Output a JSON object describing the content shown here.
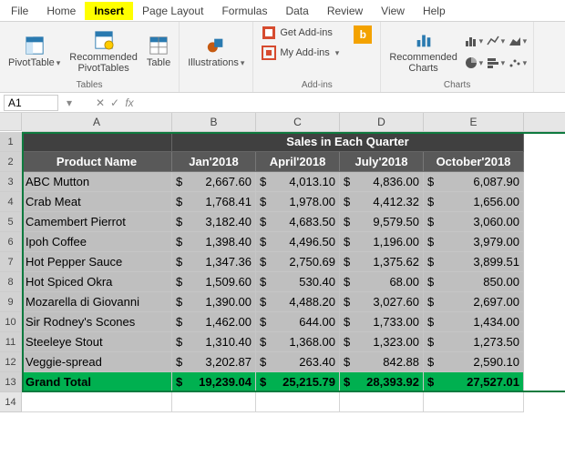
{
  "menu": {
    "items": [
      "File",
      "Home",
      "Insert",
      "Page Layout",
      "Formulas",
      "Data",
      "Review",
      "View",
      "Help"
    ],
    "active": "Insert"
  },
  "ribbon": {
    "tables": {
      "label": "Tables",
      "pivottable": "PivotTable",
      "recommended_pivot": "Recommended\nPivotTables",
      "table": "Table"
    },
    "illustrations": {
      "label": "Illustrations",
      "btn": "Illustrations"
    },
    "addins": {
      "label": "Add-ins",
      "get": "Get Add-ins",
      "my": "My Add-ins",
      "bing": "b"
    },
    "charts": {
      "label": "Charts",
      "recommended": "Recommended\nCharts"
    }
  },
  "name_box": "A1",
  "formula_bar": "",
  "columns": [
    "A",
    "B",
    "C",
    "D",
    "E"
  ],
  "table": {
    "title": "Sales in Each Quarter",
    "headers": [
      "Product Name",
      "Jan'2018",
      "April'2018",
      "July'2018",
      "October'2018"
    ],
    "rows": [
      {
        "name": "ABC Mutton",
        "v": [
          "2,667.60",
          "4,013.10",
          "4,836.00",
          "6,087.90"
        ]
      },
      {
        "name": "Crab Meat",
        "v": [
          "1,768.41",
          "1,978.00",
          "4,412.32",
          "1,656.00"
        ]
      },
      {
        "name": "Camembert Pierrot",
        "v": [
          "3,182.40",
          "4,683.50",
          "9,579.50",
          "3,060.00"
        ]
      },
      {
        "name": "Ipoh Coffee",
        "v": [
          "1,398.40",
          "4,496.50",
          "1,196.00",
          "3,979.00"
        ]
      },
      {
        "name": "Hot Pepper Sauce",
        "v": [
          "1,347.36",
          "2,750.69",
          "1,375.62",
          "3,899.51"
        ]
      },
      {
        "name": " Hot Spiced Okra",
        "v": [
          "1,509.60",
          "530.40",
          "68.00",
          "850.00"
        ]
      },
      {
        "name": "Mozarella di Giovanni",
        "v": [
          "1,390.00",
          "4,488.20",
          "3,027.60",
          "2,697.00"
        ]
      },
      {
        "name": "Sir Rodney's Scones",
        "v": [
          "1,462.00",
          "644.00",
          "1,733.00",
          "1,434.00"
        ]
      },
      {
        "name": "Steeleye Stout",
        "v": [
          "1,310.40",
          "1,368.00",
          "1,323.00",
          "1,273.50"
        ]
      },
      {
        "name": "Veggie-spread",
        "v": [
          "3,202.87",
          "263.40",
          "842.88",
          "2,590.10"
        ]
      }
    ],
    "total": {
      "label": "Grand Total",
      "v": [
        "19,239.04",
        "25,215.79",
        "28,393.92",
        "27,527.01"
      ]
    }
  },
  "chart_data": {
    "type": "table",
    "title": "Sales in Each Quarter",
    "categories": [
      "Jan'2018",
      "April'2018",
      "July'2018",
      "October'2018"
    ],
    "series": [
      {
        "name": "ABC Mutton",
        "values": [
          2667.6,
          4013.1,
          4836.0,
          6087.9
        ]
      },
      {
        "name": "Crab Meat",
        "values": [
          1768.41,
          1978.0,
          4412.32,
          1656.0
        ]
      },
      {
        "name": "Camembert Pierrot",
        "values": [
          3182.4,
          4683.5,
          9579.5,
          3060.0
        ]
      },
      {
        "name": "Ipoh Coffee",
        "values": [
          1398.4,
          4496.5,
          1196.0,
          3979.0
        ]
      },
      {
        "name": "Hot Pepper Sauce",
        "values": [
          1347.36,
          2750.69,
          1375.62,
          3899.51
        ]
      },
      {
        "name": "Hot Spiced Okra",
        "values": [
          1509.6,
          530.4,
          68.0,
          850.0
        ]
      },
      {
        "name": "Mozarella di Giovanni",
        "values": [
          1390.0,
          4488.2,
          3027.6,
          2697.0
        ]
      },
      {
        "name": "Sir Rodney's Scones",
        "values": [
          1462.0,
          644.0,
          1733.0,
          1434.0
        ]
      },
      {
        "name": "Steeleye Stout",
        "values": [
          1310.4,
          1368.0,
          1323.0,
          1273.5
        ]
      },
      {
        "name": "Veggie-spread",
        "values": [
          3202.87,
          263.4,
          842.88,
          2590.1
        ]
      }
    ],
    "totals": [
      19239.04,
      25215.79,
      28393.92,
      27527.01
    ]
  }
}
